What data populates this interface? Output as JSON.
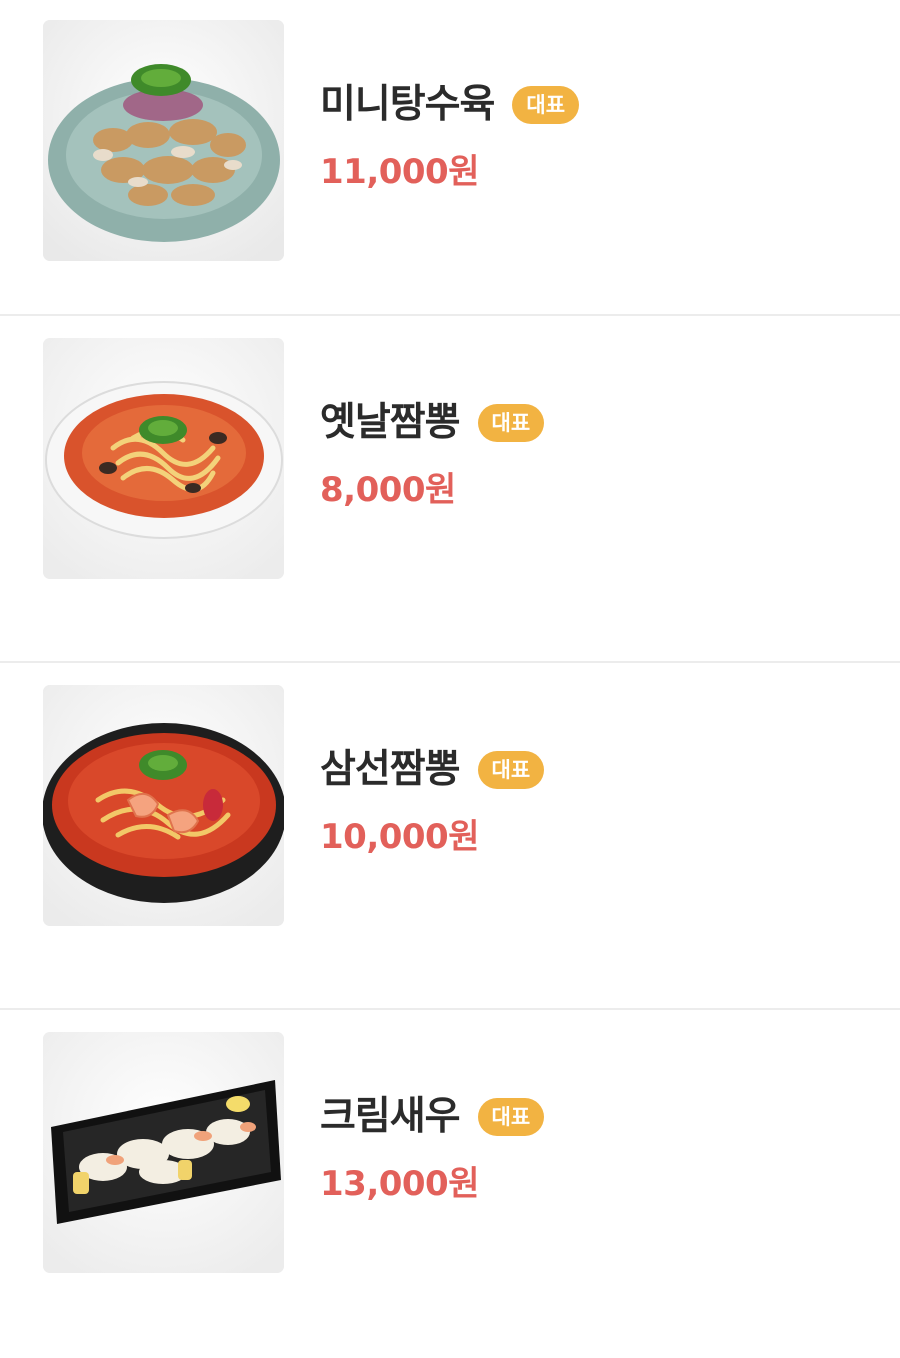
{
  "menu": {
    "items": [
      {
        "name": "미니탕수육",
        "badge": "대표",
        "price": "11,000원",
        "image_icon": "sweet-and-sour-pork-photo"
      },
      {
        "name": "옛날짬뽕",
        "badge": "대표",
        "price": "8,000원",
        "image_icon": "jjamppong-photo"
      },
      {
        "name": "삼선짬뽕",
        "badge": "대표",
        "price": "10,000원",
        "image_icon": "seafood-jjamppong-photo"
      },
      {
        "name": "크림새우",
        "badge": "대표",
        "price": "13,000원",
        "image_icon": "cream-shrimp-photo"
      }
    ]
  },
  "colors": {
    "badge": "#f2b342",
    "price": "#e2605a",
    "name": "#2b2b2b",
    "divider": "#ececec"
  }
}
